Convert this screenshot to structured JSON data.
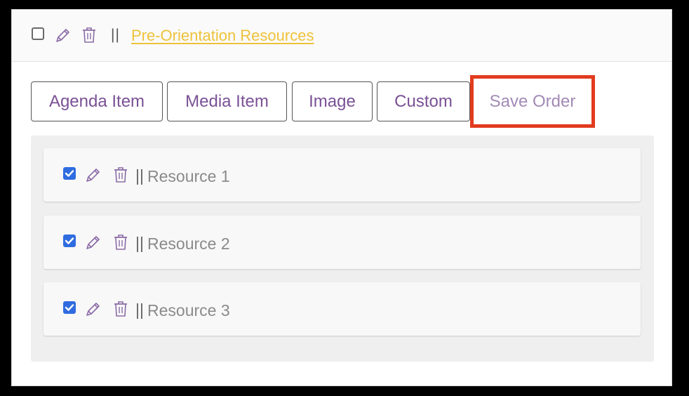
{
  "section": {
    "title": "Pre-Orientation Resources",
    "separator": "||"
  },
  "toolbar": {
    "buttons": [
      "Agenda Item",
      "Media Item",
      "Image",
      "Custom",
      "Save Order"
    ]
  },
  "resources": [
    {
      "label": "Resource 1",
      "separator": "||",
      "checked": true
    },
    {
      "label": "Resource 2",
      "separator": "||",
      "checked": true
    },
    {
      "label": "Resource 3",
      "separator": "||",
      "checked": true
    }
  ],
  "colors": {
    "accent_purple": "#7a5196",
    "title_link": "#eec23a",
    "highlight_red": "#e23b1f",
    "checkbox_blue": "#2f6ce0"
  },
  "icons": [
    "pencil-icon",
    "trash-icon",
    "checkbox"
  ]
}
